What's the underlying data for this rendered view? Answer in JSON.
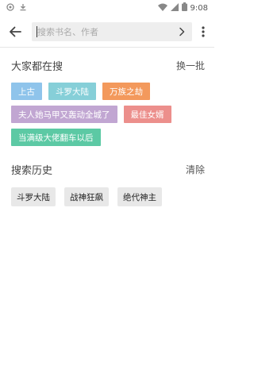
{
  "status_bar": {
    "time": "9:08",
    "icons": [
      "notification-icon",
      "download-icon",
      "wifi-icon",
      "signal-icon",
      "battery-icon"
    ]
  },
  "toolbar": {
    "back_icon": "arrow-left-icon",
    "search_placeholder": "搜索书名、作者",
    "search_value": "",
    "go_icon": "chevron-right-icon",
    "more_icon": "more-vert-icon"
  },
  "hot_search": {
    "title": "大家都在搜",
    "refresh_label": "换一批",
    "tags": [
      {
        "label": "上古",
        "color": "#8fc4eb"
      },
      {
        "label": "斗罗大陆",
        "color": "#86cfd8"
      },
      {
        "label": "万族之劫",
        "color": "#f3995c"
      },
      {
        "label": "夫人她马甲又轰动全城了",
        "color": "#c1a6d2"
      },
      {
        "label": "最佳女婿",
        "color": "#ec8f8c"
      },
      {
        "label": "当满级大佬翻车以后",
        "color": "#5cc9a4"
      }
    ]
  },
  "history": {
    "title": "搜索历史",
    "clear_label": "清除",
    "items": [
      "斗罗大陆",
      "战神狂飙",
      "绝代神主"
    ]
  }
}
